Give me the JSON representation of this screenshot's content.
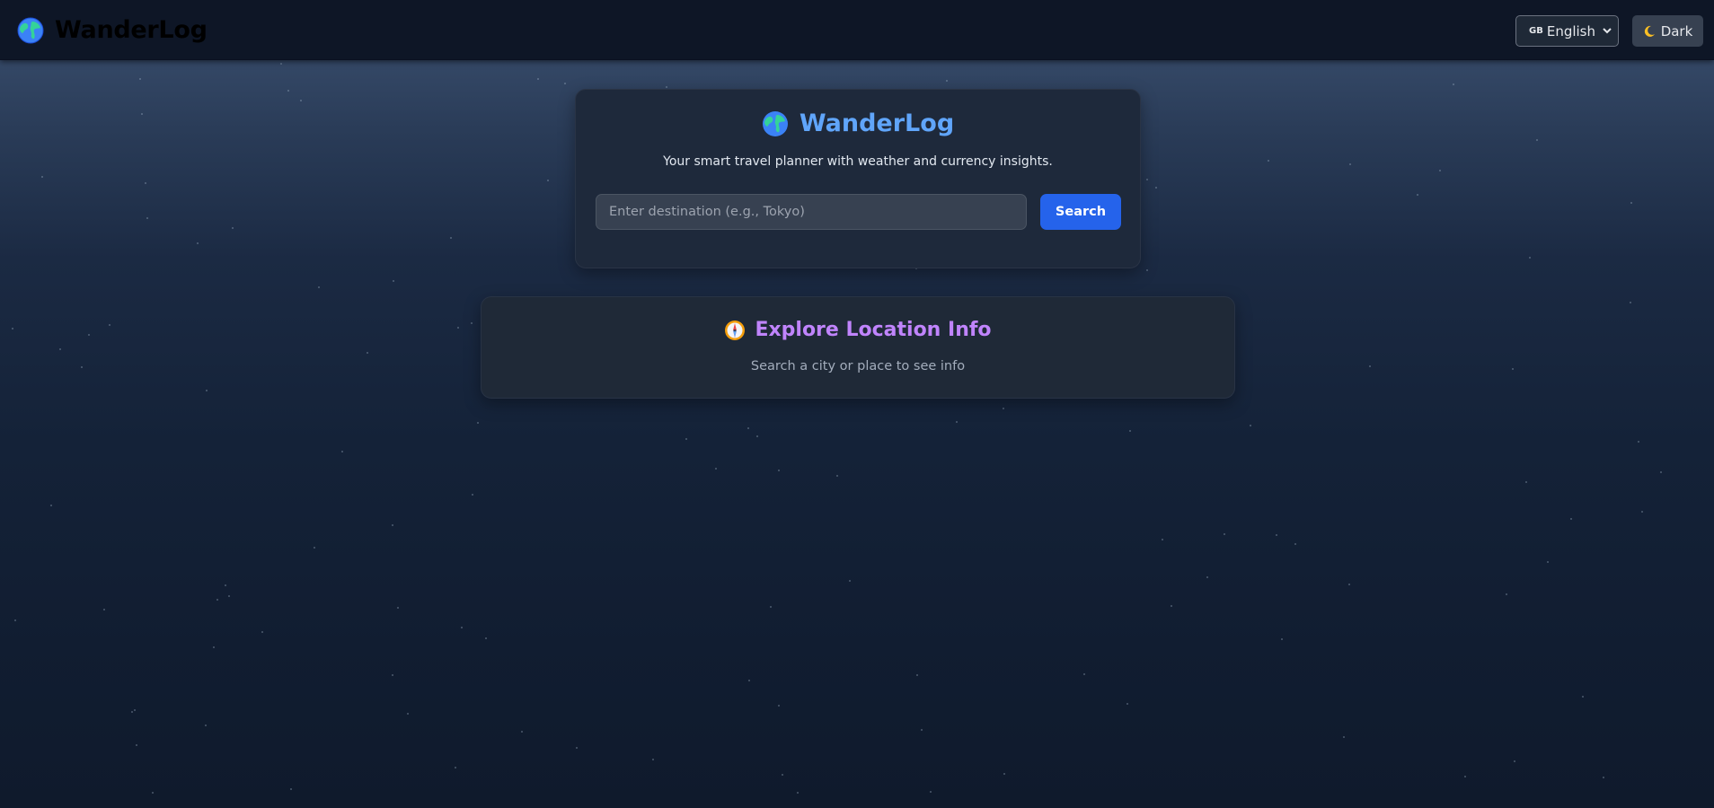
{
  "navbar": {
    "brand_icon": "globe-icon",
    "brand_name": "WanderLog",
    "language": {
      "flag": "GB",
      "selected": "English"
    },
    "theme_toggle": {
      "icon": "moon-icon",
      "label": "Dark"
    }
  },
  "search_card": {
    "icon": "globe-icon",
    "title": "WanderLog",
    "tagline": "Your smart travel planner with weather and currency insights.",
    "input_placeholder": "Enter destination (e.g., Tokyo)",
    "input_value": "",
    "search_label": "Search"
  },
  "info_card": {
    "icon": "compass-icon",
    "title": "Explore Location Info",
    "subtitle": "Search a city or place to see info"
  },
  "colors": {
    "accent_blue": "#2563eb",
    "title_blue": "#60a5fa",
    "title_purple": "#c084fc",
    "card_bg": "#1e293b"
  }
}
